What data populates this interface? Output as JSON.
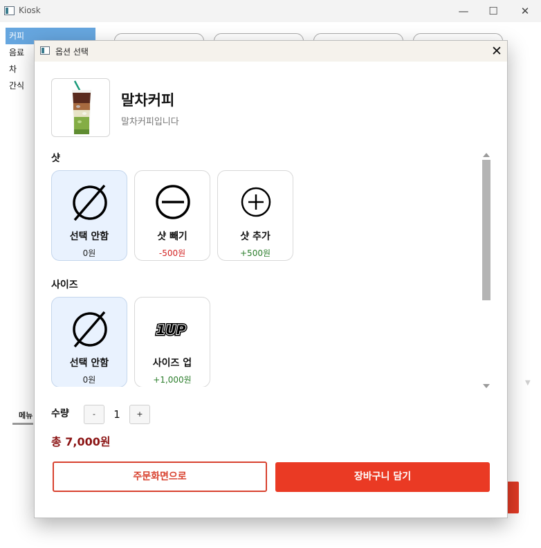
{
  "window": {
    "title": "Kiosk",
    "minimize_icon": "minimize-icon",
    "maximize_icon": "maximize-icon",
    "close_icon": "close-icon"
  },
  "sidebar": {
    "categories": [
      {
        "label": "커피",
        "active": true
      },
      {
        "label": "음료",
        "active": false
      },
      {
        "label": "차",
        "active": false
      },
      {
        "label": "간식",
        "active": false
      }
    ]
  },
  "background": {
    "menu_tab_label": "메뉴"
  },
  "dialog": {
    "title": "옵션 선택",
    "close_glyph": "✕",
    "product": {
      "name": "말차커피",
      "description": "말차커피입니다",
      "image_icon": "iced-matcha-coffee-image"
    },
    "option_groups": [
      {
        "title": "샷",
        "options": [
          {
            "label": "선택 안함",
            "price": "0원",
            "icon": "empty-set-icon",
            "selected": true,
            "tone": "neutral"
          },
          {
            "label": "샷 빼기",
            "price": "-500원",
            "icon": "circled-minus-icon",
            "selected": false,
            "tone": "negative"
          },
          {
            "label": "샷 추가",
            "price": "+500원",
            "icon": "circled-plus-icon",
            "selected": false,
            "tone": "positive"
          }
        ]
      },
      {
        "title": "사이즈",
        "options": [
          {
            "label": "선택 안함",
            "price": "0원",
            "icon": "empty-set-icon",
            "selected": true,
            "tone": "neutral"
          },
          {
            "label": "사이즈 업",
            "price": "+1,000원",
            "icon": "size-up-1up-icon",
            "selected": false,
            "tone": "positive"
          }
        ]
      }
    ],
    "quantity": {
      "label": "수량",
      "minus": "-",
      "value": "1",
      "plus": "+"
    },
    "total": "총 7,000원",
    "buttons": {
      "back": "주문화면으로",
      "add_to_cart": "장바구니 담기"
    },
    "colors": {
      "accent": "#ea3a24",
      "selected_card": "#e9f2fe",
      "negative": "#d32222",
      "positive": "#2a7d2a",
      "total": "#8b1414"
    }
  }
}
